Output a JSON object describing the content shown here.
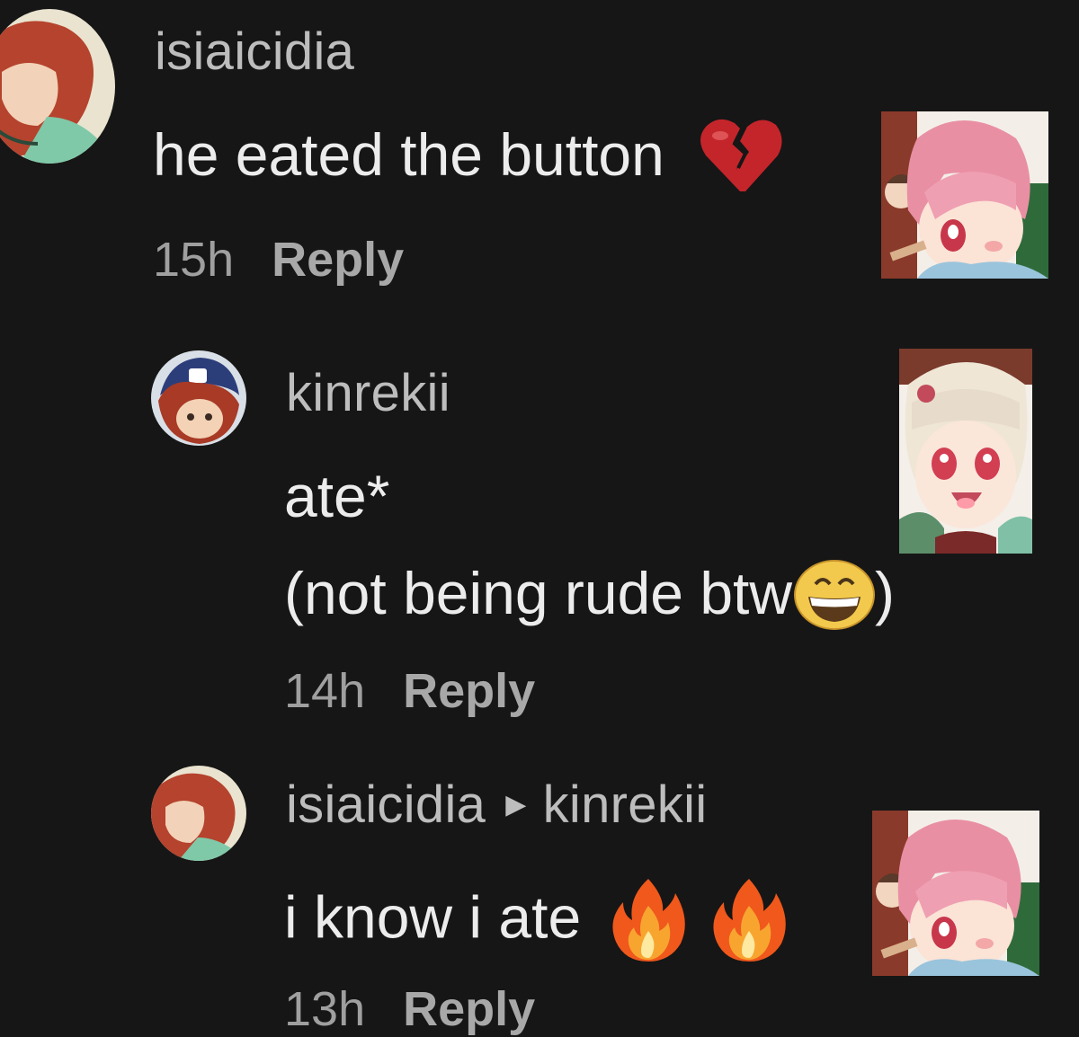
{
  "comments": [
    {
      "username": "isiaicidia",
      "lines": [
        "he eated the button"
      ],
      "emoji": "broken-heart-icon",
      "time": "15h",
      "reply_label": "Reply"
    },
    {
      "username": "kinrekii",
      "lines": [
        "ate*",
        "(not being rude btw",
        ")"
      ],
      "emoji": "grinning-face-icon",
      "time": "14h",
      "reply_label": "Reply"
    },
    {
      "username": "isiaicidia",
      "reply_to": "kinrekii",
      "lines": [
        "i know i ate"
      ],
      "emoji": "fire-icon",
      "time": "13h",
      "reply_label": "Reply"
    }
  ],
  "colors": {
    "background": "#161616",
    "username": "#bdbdbd",
    "text": "#ececec",
    "meta": "#9f9f9f"
  }
}
